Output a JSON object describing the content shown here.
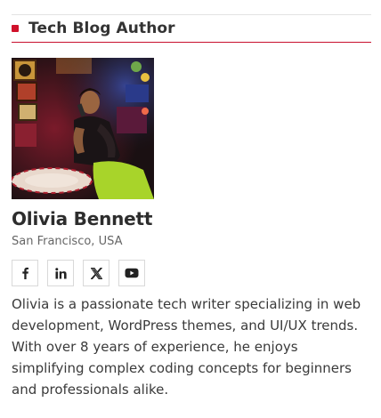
{
  "widget": {
    "title": "Tech Blog Author"
  },
  "author": {
    "name": "Olivia Bennett",
    "location": "San Francisco, USA",
    "bio": "Olivia is a passionate tech writer specializing in web development, WordPress themes, and UI/UX trends. With over 8 years of experience, he enjoys simplifying complex coding concepts for beginners and professionals alike."
  },
  "socials": [
    {
      "icon": "facebook-icon"
    },
    {
      "icon": "linkedin-icon"
    },
    {
      "icon": "x-twitter-icon"
    },
    {
      "icon": "youtube-icon"
    }
  ],
  "colors": {
    "accent": "#d0112b",
    "text": "#333333",
    "muted": "#666666"
  }
}
